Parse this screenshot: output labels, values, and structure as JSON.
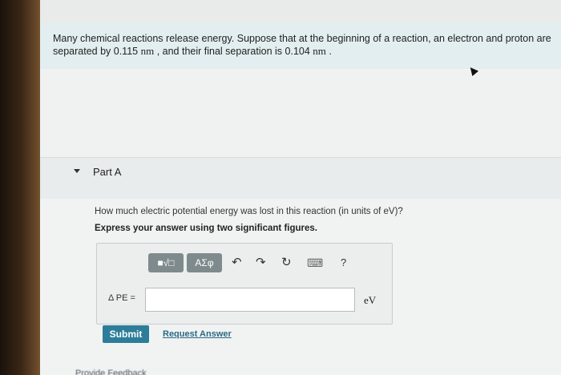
{
  "problem": {
    "text_before_1": "Many chemical reactions release energy. Suppose that at the beginning of a reaction, an electron and proton are separated by ",
    "initial_value": "0.115",
    "initial_unit": "nm",
    "text_middle": " , and their final separation is ",
    "final_value": "0.104",
    "final_unit": "nm",
    "text_end": " ."
  },
  "part": {
    "title": "Part A",
    "question": "How much electric potential energy was lost in this reaction (in units of eV)?",
    "instruction": "Express your answer using two significant figures."
  },
  "toolbar": {
    "template_button_label": "■√□",
    "symbols_button_label": "AΣφ",
    "undo_icon": "↶",
    "redo_icon": "↷",
    "reset_icon": "↻",
    "keyboard_icon": "⌨",
    "help_icon": "?"
  },
  "answer": {
    "label": "Δ PE =",
    "value": "",
    "unit": "eV"
  },
  "actions": {
    "submit_label": "Submit",
    "request_answer_label": "Request Answer",
    "provide_feedback_label": "Provide Feedback"
  }
}
